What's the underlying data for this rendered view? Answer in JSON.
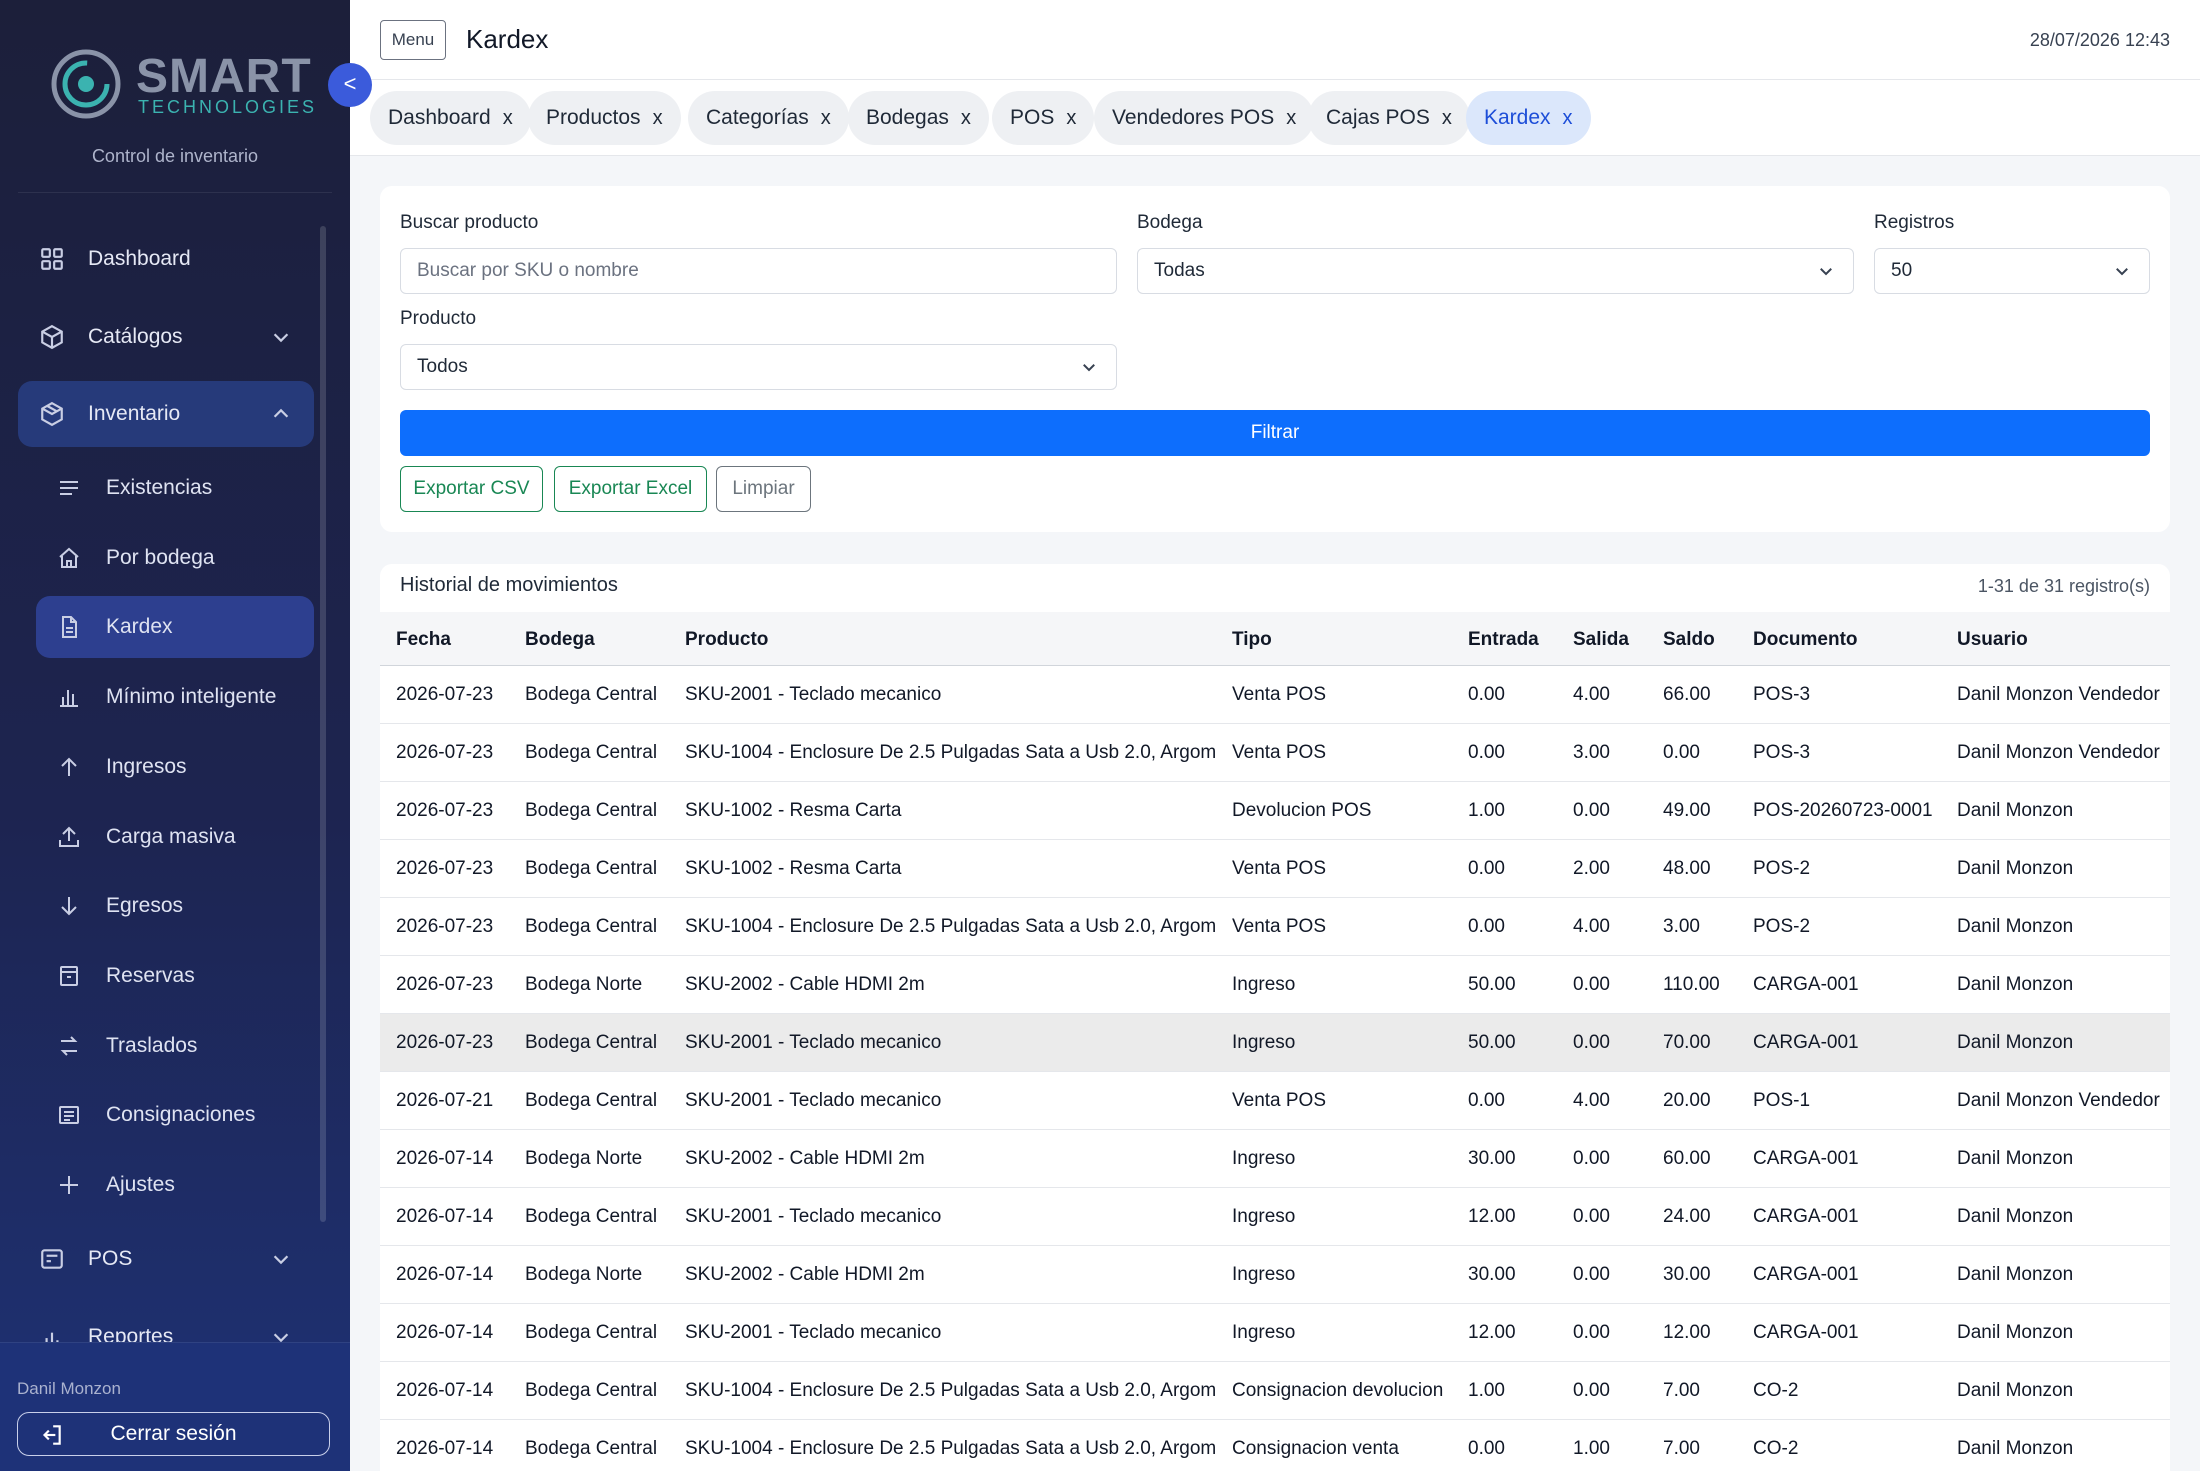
{
  "brand": {
    "name": "SMART",
    "sub": "TECHNOLOGIES",
    "caption": "Control de inventario"
  },
  "collapse_label": "<",
  "nav": {
    "dashboard": "Dashboard",
    "catalogos": "Catálogos",
    "inventario": "Inventario",
    "inventario_items": [
      {
        "label": "Existencias",
        "icon": "list-icon"
      },
      {
        "label": "Por bodega",
        "icon": "home-icon"
      },
      {
        "label": "Kardex",
        "icon": "document-icon"
      },
      {
        "label": "Mínimo inteligente",
        "icon": "bar-chart-icon"
      },
      {
        "label": "Ingresos",
        "icon": "arrow-up-icon"
      },
      {
        "label": "Carga masiva",
        "icon": "upload-icon"
      },
      {
        "label": "Egresos",
        "icon": "arrow-down-icon"
      },
      {
        "label": "Reservas",
        "icon": "box-icon"
      },
      {
        "label": "Traslados",
        "icon": "transfer-icon"
      },
      {
        "label": "Consignaciones",
        "icon": "clipboard-icon"
      },
      {
        "label": "Ajustes",
        "icon": "plus-icon"
      }
    ],
    "pos": "POS",
    "reportes": "Reportes"
  },
  "footer": {
    "user": "Danil Monzon",
    "logout": "Cerrar sesión"
  },
  "header": {
    "menu": "Menu",
    "title": "Kardex",
    "datetime": "28/07/2026 12:43"
  },
  "tabs": [
    {
      "label": "Dashboard",
      "close": "x"
    },
    {
      "label": "Productos",
      "close": "x"
    },
    {
      "label": "Categorías",
      "close": "x"
    },
    {
      "label": "Bodegas",
      "close": "x"
    },
    {
      "label": "POS",
      "close": "x"
    },
    {
      "label": "Vendedores POS",
      "close": "x"
    },
    {
      "label": "Cajas POS",
      "close": "x"
    },
    {
      "label": "Kardex",
      "close": "x"
    }
  ],
  "filters": {
    "search_label": "Buscar producto",
    "search_placeholder": "Buscar por SKU o nombre",
    "bodega_label": "Bodega",
    "bodega_value": "Todas",
    "registros_label": "Registros",
    "registros_value": "50",
    "producto_label": "Producto",
    "producto_value": "Todos",
    "filtrar": "Filtrar",
    "export_csv": "Exportar CSV",
    "export_excel": "Exportar Excel",
    "limpiar": "Limpiar"
  },
  "table": {
    "title": "Historial de movimientos",
    "count": "1-31 de 31 registro(s)",
    "columns": [
      "Fecha",
      "Bodega",
      "Producto",
      "Tipo",
      "Entrada",
      "Salida",
      "Saldo",
      "Documento",
      "Usuario"
    ],
    "rows": [
      [
        "2026-07-23",
        "Bodega Central",
        "SKU-2001 - Teclado mecanico",
        "Venta POS",
        "0.00",
        "4.00",
        "66.00",
        "POS-3",
        "Danil Monzon Vendedor"
      ],
      [
        "2026-07-23",
        "Bodega Central",
        "SKU-1004 - Enclosure De 2.5 Pulgadas Sata a Usb 2.0, Argom",
        "Venta POS",
        "0.00",
        "3.00",
        "0.00",
        "POS-3",
        "Danil Monzon Vendedor"
      ],
      [
        "2026-07-23",
        "Bodega Central",
        "SKU-1002 - Resma Carta",
        "Devolucion POS",
        "1.00",
        "0.00",
        "49.00",
        "POS-20260723-0001",
        "Danil Monzon"
      ],
      [
        "2026-07-23",
        "Bodega Central",
        "SKU-1002 - Resma Carta",
        "Venta POS",
        "0.00",
        "2.00",
        "48.00",
        "POS-2",
        "Danil Monzon"
      ],
      [
        "2026-07-23",
        "Bodega Central",
        "SKU-1004 - Enclosure De 2.5 Pulgadas Sata a Usb 2.0, Argom",
        "Venta POS",
        "0.00",
        "4.00",
        "3.00",
        "POS-2",
        "Danil Monzon"
      ],
      [
        "2026-07-23",
        "Bodega Norte",
        "SKU-2002 - Cable HDMI 2m",
        "Ingreso",
        "50.00",
        "0.00",
        "110.00",
        "CARGA-001",
        "Danil Monzon"
      ],
      [
        "2026-07-23",
        "Bodega Central",
        "SKU-2001 - Teclado mecanico",
        "Ingreso",
        "50.00",
        "0.00",
        "70.00",
        "CARGA-001",
        "Danil Monzon"
      ],
      [
        "2026-07-21",
        "Bodega Central",
        "SKU-2001 - Teclado mecanico",
        "Venta POS",
        "0.00",
        "4.00",
        "20.00",
        "POS-1",
        "Danil Monzon Vendedor"
      ],
      [
        "2026-07-14",
        "Bodega Norte",
        "SKU-2002 - Cable HDMI 2m",
        "Ingreso",
        "30.00",
        "0.00",
        "60.00",
        "CARGA-001",
        "Danil Monzon"
      ],
      [
        "2026-07-14",
        "Bodega Central",
        "SKU-2001 - Teclado mecanico",
        "Ingreso",
        "12.00",
        "0.00",
        "24.00",
        "CARGA-001",
        "Danil Monzon"
      ],
      [
        "2026-07-14",
        "Bodega Norte",
        "SKU-2002 - Cable HDMI 2m",
        "Ingreso",
        "30.00",
        "0.00",
        "30.00",
        "CARGA-001",
        "Danil Monzon"
      ],
      [
        "2026-07-14",
        "Bodega Central",
        "SKU-2001 - Teclado mecanico",
        "Ingreso",
        "12.00",
        "0.00",
        "12.00",
        "CARGA-001",
        "Danil Monzon"
      ],
      [
        "2026-07-14",
        "Bodega Central",
        "SKU-1004 - Enclosure De 2.5 Pulgadas Sata a Usb 2.0, Argom",
        "Consignacion devolucion",
        "1.00",
        "0.00",
        "7.00",
        "CO-2",
        "Danil Monzon"
      ],
      [
        "2026-07-14",
        "Bodega Central",
        "SKU-1004 - Enclosure De 2.5 Pulgadas Sata a Usb 2.0, Argom",
        "Consignacion venta",
        "0.00",
        "1.00",
        "7.00",
        "CO-2",
        "Danil Monzon"
      ]
    ]
  },
  "colors": {
    "primary": "#0d6efd",
    "accent": "#3b5bdb",
    "success": "#198754",
    "sidebar": "#1d2450"
  }
}
